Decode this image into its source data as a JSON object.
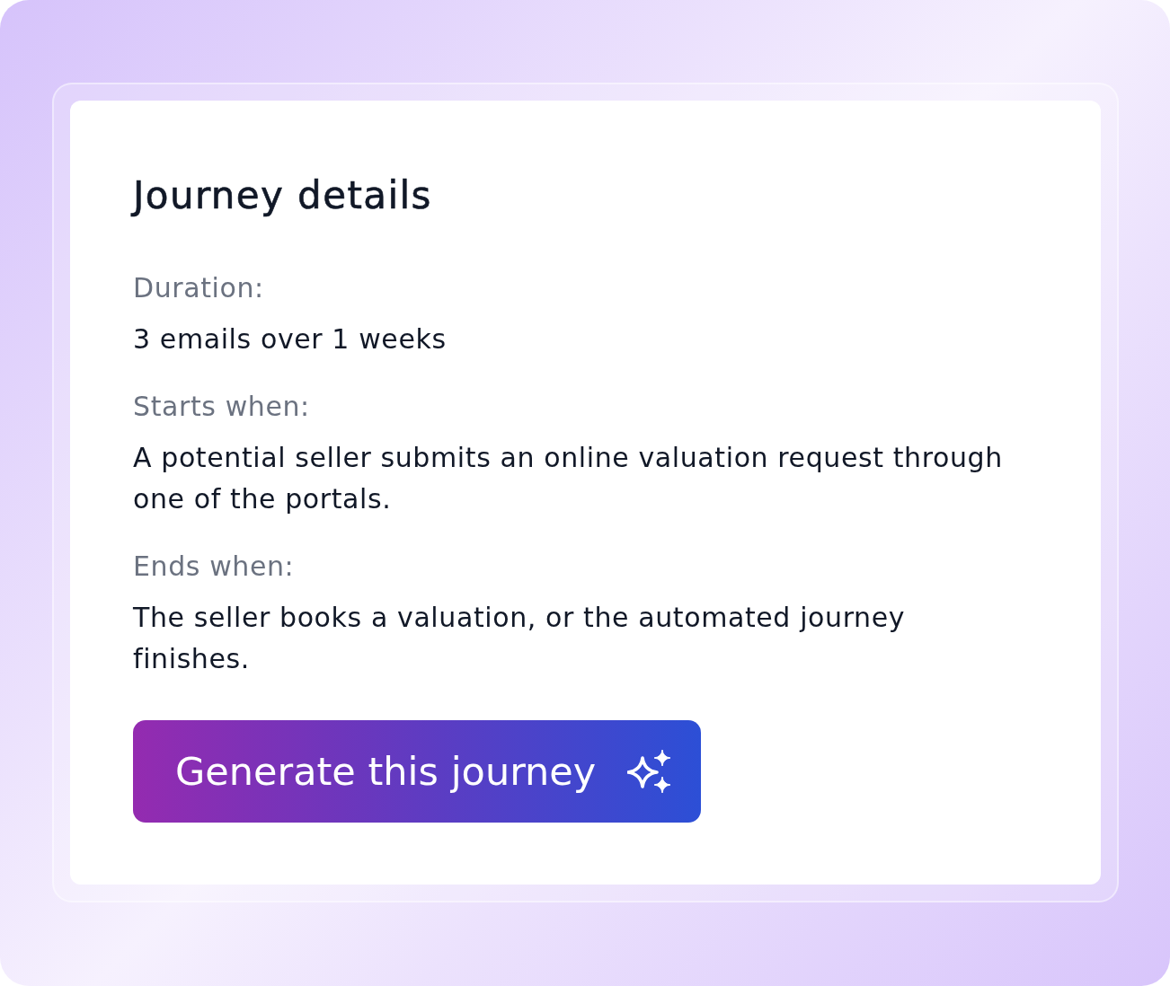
{
  "card": {
    "title": "Journey details",
    "details": [
      {
        "label": "Duration:",
        "value": "3 emails over 1 weeks"
      },
      {
        "label": "Starts when:",
        "value": "A potential seller submits an online valuation request through one of the portals."
      },
      {
        "label": "Ends when:",
        "value": "The seller books a valuation, or the automated journey finishes."
      }
    ]
  },
  "button": {
    "label": "Generate this journey"
  }
}
